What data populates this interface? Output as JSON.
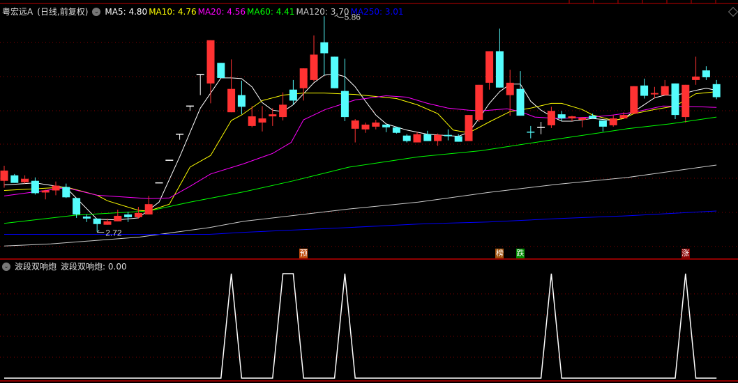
{
  "header": {
    "title": "粤宏远A",
    "period": "(日线,前复权)",
    "ma_labels": [
      {
        "label": "MA5: 4.80",
        "color": "#ffffff"
      },
      {
        "label": "MA10: 4.76",
        "color": "#ffff00"
      },
      {
        "label": "MA20: 4.56",
        "color": "#ff00ff"
      },
      {
        "label": "MA60: 4.41",
        "color": "#00ff00"
      },
      {
        "label": "MA120: 3.70",
        "color": "#cccccc"
      },
      {
        "label": "MA250: 3.01",
        "color": "#0000ff"
      }
    ]
  },
  "indicator": {
    "name": "波段双响炮",
    "value_label": "波段双响炮: 0.00"
  },
  "markers": [
    {
      "index": 29,
      "text": "预",
      "color": "#c04a0a"
    },
    {
      "index": 48,
      "text": "榜",
      "color": "#a0500a"
    },
    {
      "index": 50,
      "text": "跌",
      "color": "#008a00"
    },
    {
      "index": 66,
      "text": "涨",
      "color": "#8b0000"
    }
  ],
  "chart_data": [
    {
      "type": "candlestick",
      "title": "粤宏远A (日线,前复权)",
      "price_range": [
        2.5,
        6.0
      ],
      "high_label": "5.86",
      "low_label": "2.72",
      "high_index": 32,
      "low_index": 9,
      "up_color": "#ff3232",
      "down_color": "#54fcfc",
      "ohlc_order": [
        "open",
        "high",
        "low",
        "close"
      ],
      "candles": [
        [
          3.46,
          3.68,
          3.36,
          3.61
        ],
        [
          3.54,
          3.56,
          3.43,
          3.43
        ],
        [
          3.44,
          3.54,
          3.42,
          3.49
        ],
        [
          3.46,
          3.51,
          3.26,
          3.28
        ],
        [
          3.29,
          3.33,
          3.19,
          3.32
        ],
        [
          3.32,
          3.45,
          3.25,
          3.39
        ],
        [
          3.37,
          3.42,
          3.21,
          3.22
        ],
        [
          3.21,
          3.21,
          2.92,
          2.97
        ],
        [
          2.94,
          2.97,
          2.86,
          2.91
        ],
        [
          2.91,
          2.91,
          2.72,
          2.83
        ],
        [
          2.82,
          2.91,
          2.82,
          2.87
        ],
        [
          2.87,
          3.04,
          2.87,
          2.95
        ],
        [
          2.97,
          3.01,
          2.86,
          2.93
        ],
        [
          2.93,
          3.08,
          2.91,
          2.99
        ],
        [
          2.97,
          3.24,
          2.97,
          3.12
        ],
        [
          3.43,
          3.43,
          3.43,
          3.43
        ],
        [
          3.76,
          3.76,
          3.76,
          3.76
        ],
        [
          4.14,
          4.14,
          4.06,
          4.14
        ],
        [
          4.55,
          4.55,
          4.48,
          4.55
        ],
        [
          5.01,
          5.01,
          4.71,
          5.01
        ],
        [
          4.88,
          5.51,
          4.59,
          5.51
        ],
        [
          5.18,
          5.18,
          4.96,
          4.96
        ],
        [
          4.46,
          5.23,
          4.46,
          4.8
        ],
        [
          4.71,
          4.92,
          4.43,
          4.54
        ],
        [
          4.26,
          4.55,
          4.24,
          4.4
        ],
        [
          4.31,
          4.55,
          4.18,
          4.37
        ],
        [
          4.4,
          4.52,
          4.26,
          4.43
        ],
        [
          4.39,
          4.75,
          4.34,
          4.57
        ],
        [
          4.79,
          4.93,
          4.57,
          4.63
        ],
        [
          4.81,
          5.1,
          4.63,
          5.1
        ],
        [
          4.93,
          5.58,
          4.91,
          5.3
        ],
        [
          5.48,
          5.86,
          5.0,
          5.32
        ],
        [
          5.27,
          5.27,
          4.81,
          4.81
        ],
        [
          4.77,
          5.24,
          4.33,
          4.39
        ],
        [
          4.22,
          4.36,
          4.02,
          4.34
        ],
        [
          4.21,
          4.31,
          4.16,
          4.28
        ],
        [
          4.25,
          4.35,
          4.21,
          4.31
        ],
        [
          4.28,
          4.28,
          4.17,
          4.24
        ],
        [
          4.24,
          4.25,
          4.15,
          4.16
        ],
        [
          4.12,
          4.14,
          4.02,
          4.04
        ],
        [
          4.02,
          4.17,
          4.02,
          4.14
        ],
        [
          4.14,
          4.19,
          4.04,
          4.04
        ],
        [
          4.04,
          4.15,
          3.97,
          4.13
        ],
        [
          4.13,
          4.21,
          4.05,
          4.11
        ],
        [
          4.11,
          4.14,
          4.03,
          4.03
        ],
        [
          4.04,
          4.42,
          4.04,
          4.42
        ],
        [
          4.35,
          4.86,
          4.32,
          4.86
        ],
        [
          4.89,
          5.35,
          4.79,
          5.35
        ],
        [
          5.35,
          5.68,
          4.82,
          4.82
        ],
        [
          4.71,
          5.08,
          4.41,
          4.89
        ],
        [
          4.8,
          5.06,
          4.41,
          4.41
        ],
        [
          4.18,
          4.26,
          4.08,
          4.17
        ],
        [
          4.24,
          4.32,
          4.14,
          4.24
        ],
        [
          4.27,
          4.54,
          4.23,
          4.48
        ],
        [
          4.43,
          4.48,
          4.33,
          4.37
        ],
        [
          4.37,
          4.41,
          4.33,
          4.4
        ],
        [
          4.35,
          4.39,
          4.24,
          4.38
        ],
        [
          4.41,
          4.44,
          4.37,
          4.37
        ],
        [
          4.34,
          4.34,
          4.18,
          4.25
        ],
        [
          4.27,
          4.42,
          4.25,
          4.37
        ],
        [
          4.37,
          4.46,
          4.37,
          4.42
        ],
        [
          4.44,
          4.84,
          4.44,
          4.84
        ],
        [
          4.85,
          4.95,
          4.66,
          4.7
        ],
        [
          4.72,
          4.83,
          4.66,
          4.74
        ],
        [
          4.71,
          4.93,
          4.71,
          4.84
        ],
        [
          4.88,
          4.88,
          4.36,
          4.42
        ],
        [
          4.39,
          4.86,
          4.31,
          4.86
        ],
        [
          4.93,
          5.27,
          4.86,
          4.98
        ],
        [
          5.07,
          5.13,
          4.93,
          4.97
        ],
        [
          4.87,
          4.93,
          4.65,
          4.68
        ]
      ],
      "moving_averages": [
        {
          "name": "MA5",
          "color": "#ffffff",
          "points": [
            [
              0,
              3.4
            ],
            [
              3,
              3.43
            ],
            [
              6,
              3.36
            ],
            [
              9,
              2.9
            ],
            [
              11,
              2.89
            ],
            [
              13,
              2.92
            ],
            [
              15,
              3.15
            ],
            [
              17,
              3.81
            ],
            [
              19,
              4.52
            ],
            [
              21,
              4.96
            ],
            [
              22,
              4.96
            ],
            [
              23,
              4.95
            ],
            [
              24,
              4.83
            ],
            [
              25,
              4.6
            ],
            [
              26,
              4.49
            ],
            [
              27,
              4.47
            ],
            [
              28,
              4.57
            ],
            [
              30,
              4.89
            ],
            [
              31,
              5.0
            ],
            [
              32,
              5.02
            ],
            [
              33,
              4.98
            ],
            [
              34,
              4.83
            ],
            [
              35,
              4.62
            ],
            [
              36,
              4.42
            ],
            [
              37,
              4.29
            ],
            [
              39,
              4.2
            ],
            [
              41,
              4.14
            ],
            [
              43,
              4.12
            ],
            [
              44,
              4.11
            ],
            [
              45,
              4.17
            ],
            [
              46,
              4.37
            ],
            [
              47,
              4.59
            ],
            [
              48,
              4.76
            ],
            [
              49,
              4.87
            ],
            [
              50,
              4.87
            ],
            [
              51,
              4.62
            ],
            [
              52,
              4.49
            ],
            [
              53,
              4.4
            ],
            [
              54,
              4.33
            ],
            [
              55,
              4.33
            ],
            [
              57,
              4.37
            ],
            [
              59,
              4.34
            ],
            [
              60,
              4.37
            ],
            [
              61,
              4.47
            ],
            [
              63,
              4.67
            ],
            [
              64,
              4.71
            ],
            [
              65,
              4.71
            ],
            [
              66,
              4.74
            ],
            [
              67,
              4.78
            ],
            [
              68,
              4.81
            ],
            [
              69,
              4.78
            ]
          ]
        },
        {
          "name": "MA10",
          "color": "#ffff00",
          "points": [
            [
              0,
              3.32
            ],
            [
              6,
              3.37
            ],
            [
              9,
              3.25
            ],
            [
              10,
              3.17
            ],
            [
              13,
              3.03
            ],
            [
              14,
              3.02
            ],
            [
              16,
              3.12
            ],
            [
              18,
              3.66
            ],
            [
              20,
              3.83
            ],
            [
              22,
              4.34
            ],
            [
              23,
              4.42
            ],
            [
              25,
              4.63
            ],
            [
              27,
              4.71
            ],
            [
              29,
              4.74
            ],
            [
              31,
              4.74
            ],
            [
              34,
              4.72
            ],
            [
              36,
              4.69
            ],
            [
              38,
              4.66
            ],
            [
              40,
              4.57
            ],
            [
              42,
              4.44
            ],
            [
              43.5,
              4.2
            ],
            [
              45,
              4.16
            ],
            [
              46,
              4.24
            ],
            [
              47,
              4.32
            ],
            [
              49,
              4.47
            ],
            [
              51,
              4.52
            ],
            [
              53,
              4.59
            ],
            [
              54,
              4.59
            ],
            [
              56,
              4.5
            ],
            [
              57,
              4.42
            ],
            [
              59,
              4.34
            ],
            [
              60,
              4.37
            ],
            [
              61,
              4.44
            ],
            [
              63,
              4.5
            ],
            [
              65,
              4.55
            ],
            [
              67,
              4.73
            ],
            [
              69,
              4.76
            ]
          ]
        },
        {
          "name": "MA20",
          "color": "#ff00ff",
          "points": [
            [
              0,
              3.24
            ],
            [
              6,
              3.36
            ],
            [
              9,
              3.25
            ],
            [
              14,
              3.2
            ],
            [
              16,
              3.21
            ],
            [
              18,
              3.38
            ],
            [
              20,
              3.56
            ],
            [
              23.2,
              3.71
            ],
            [
              26,
              3.86
            ],
            [
              27.8,
              4.02
            ],
            [
              29,
              4.35
            ],
            [
              31.1,
              4.5
            ],
            [
              34,
              4.64
            ],
            [
              37,
              4.7
            ],
            [
              39,
              4.68
            ],
            [
              41,
              4.59
            ],
            [
              43,
              4.52
            ],
            [
              45,
              4.49
            ],
            [
              46.2,
              4.48
            ],
            [
              48.7,
              4.51
            ],
            [
              50,
              4.47
            ],
            [
              51.4,
              4.39
            ],
            [
              53.6,
              4.37
            ],
            [
              57,
              4.39
            ],
            [
              59,
              4.42
            ],
            [
              61,
              4.46
            ],
            [
              63.8,
              4.55
            ],
            [
              67.2,
              4.54
            ],
            [
              69,
              4.53
            ]
          ]
        },
        {
          "name": "MA60",
          "color": "#00ff00",
          "points": [
            [
              0,
              2.84
            ],
            [
              7,
              2.96
            ],
            [
              14,
              3.02
            ],
            [
              18,
              3.15
            ],
            [
              23.2,
              3.3
            ],
            [
              28,
              3.46
            ],
            [
              33.4,
              3.66
            ],
            [
              40.1,
              3.81
            ],
            [
              46.2,
              3.9
            ],
            [
              53.6,
              4.07
            ],
            [
              60.4,
              4.22
            ],
            [
              64.5,
              4.29
            ],
            [
              69,
              4.39
            ]
          ]
        },
        {
          "name": "MA120",
          "color": "#cccccc",
          "points": [
            [
              0,
              2.51
            ],
            [
              4.5,
              2.54
            ],
            [
              13.1,
              2.64
            ],
            [
              19.9,
              2.78
            ],
            [
              23.2,
              2.87
            ],
            [
              33.4,
              3.05
            ],
            [
              40.1,
              3.15
            ],
            [
              46.9,
              3.29
            ],
            [
              53.6,
              3.41
            ],
            [
              60.4,
              3.51
            ],
            [
              69,
              3.69
            ]
          ]
        },
        {
          "name": "MA250",
          "color": "#0000ff",
          "points": [
            [
              0,
              2.68
            ],
            [
              9.5,
              2.68
            ],
            [
              19.9,
              2.68
            ],
            [
              23.2,
              2.71
            ],
            [
              33.4,
              2.78
            ],
            [
              40.1,
              2.83
            ],
            [
              46.9,
              2.86
            ],
            [
              53.6,
              2.91
            ],
            [
              60.4,
              2.95
            ],
            [
              69,
              3.02
            ]
          ]
        }
      ]
    },
    {
      "type": "line",
      "title": "波段双响炮",
      "ylim": [
        0,
        1
      ],
      "color": "#ffffff",
      "signal_indices": [
        22,
        27,
        28,
        33,
        53,
        66
      ]
    }
  ]
}
